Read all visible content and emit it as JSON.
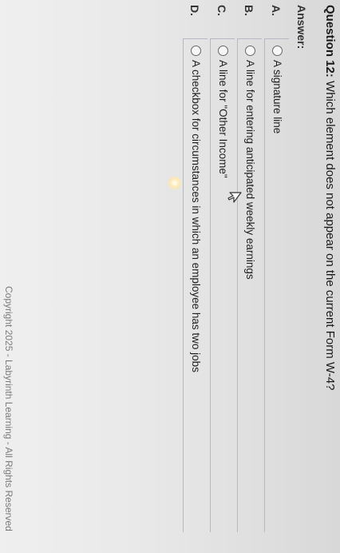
{
  "question": {
    "number_label": "Question 12:",
    "text": "Which element does not appear on the current Form W-4?"
  },
  "answer_label": "Answer:",
  "options": [
    {
      "letter": "A.",
      "text": "A signature line"
    },
    {
      "letter": "B.",
      "text": "A line for entering anticipated weekly earnings"
    },
    {
      "letter": "C.",
      "text": "A line for \"Other Income\""
    },
    {
      "letter": "D.",
      "text": "A checkbox for circumstances in which an employee has two jobs"
    }
  ],
  "footer": {
    "copyright": "Copyright 2025 - Labyrinth Learning - All Rights Reserved"
  },
  "icons": {
    "cursor": "mouse-pointer-icon",
    "radio": "radio-unselected-icon"
  }
}
